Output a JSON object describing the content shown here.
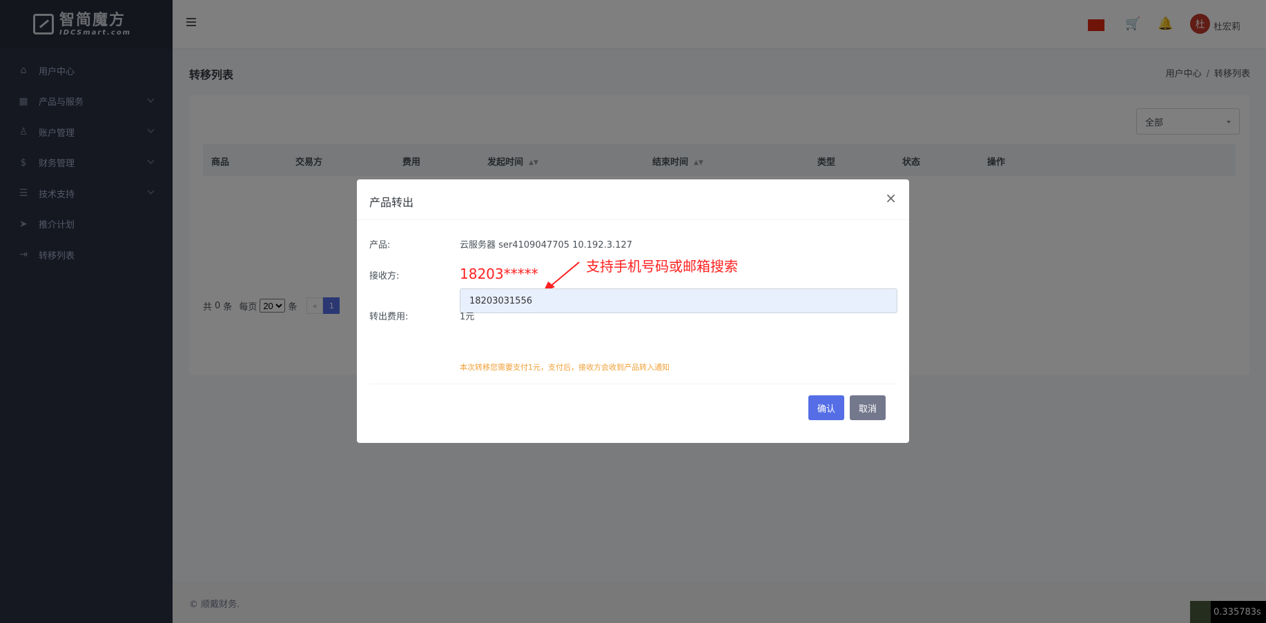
{
  "logo": {
    "cn": "智简魔方",
    "en": "IDCSmart.com"
  },
  "sidebar": {
    "items": [
      {
        "label": "用户中心",
        "icon": "home-icon",
        "glyph": "⌂",
        "has_children": false
      },
      {
        "label": "产品与服务",
        "icon": "grid-icon",
        "glyph": "▦",
        "has_children": true
      },
      {
        "label": "账户管理",
        "icon": "user-icon",
        "glyph": "♙",
        "has_children": true
      },
      {
        "label": "财务管理",
        "icon": "dollar-icon",
        "glyph": "$",
        "has_children": true
      },
      {
        "label": "技术支持",
        "icon": "list-icon",
        "glyph": "☰",
        "has_children": true
      },
      {
        "label": "推介计划",
        "icon": "send-icon",
        "glyph": "➤",
        "has_children": false
      },
      {
        "label": "转移列表",
        "icon": "transfer-icon",
        "glyph": "⇥",
        "has_children": false
      }
    ]
  },
  "header": {
    "username": "杜宏莉",
    "avatar_char": "杜",
    "cart_glyph": "🛒",
    "bell_glyph": "🔔"
  },
  "page": {
    "title": "转移列表",
    "breadcrumb": [
      "用户中心",
      "/",
      "转移列表"
    ]
  },
  "filter": {
    "selected": "全部"
  },
  "table": {
    "columns": [
      "商品",
      "交易方",
      "费用",
      "发起时间",
      "结束时间",
      "类型",
      "状态",
      "操作"
    ],
    "sort_glyph": "▲▼"
  },
  "pager": {
    "total_prefix": "共",
    "total": "0",
    "total_suffix": "条",
    "per_page_label": "每页",
    "per_page_value": "20",
    "per_page_suffix": "条",
    "prev": "«",
    "current": "1"
  },
  "footer": {
    "text": "© 顺戴财务."
  },
  "timer": {
    "text": "0.335783s"
  },
  "modal": {
    "title": "产品转出",
    "close": "×",
    "product_label": "产品:",
    "product_value": "云服务器 ser4109047705 10.192.3.127",
    "receiver_label": "接收方:",
    "receiver_masked": "18203*****",
    "annotation": "支持手机号码或邮箱搜索",
    "receiver_value": "18203031556",
    "fee_label": "转出费用:",
    "fee_value": "1元",
    "notice": "本次转移您需要支付1元，支付后，接收方会收到产品转入通知",
    "confirm": "确认",
    "cancel": "取消"
  },
  "colors": {
    "sidebar_bg": "#2a3042",
    "primary": "#556ee6",
    "secondary": "#74788d",
    "annotation_red": "#ff2020",
    "notice_orange": "#f1a036",
    "flag_red": "#de2910"
  }
}
